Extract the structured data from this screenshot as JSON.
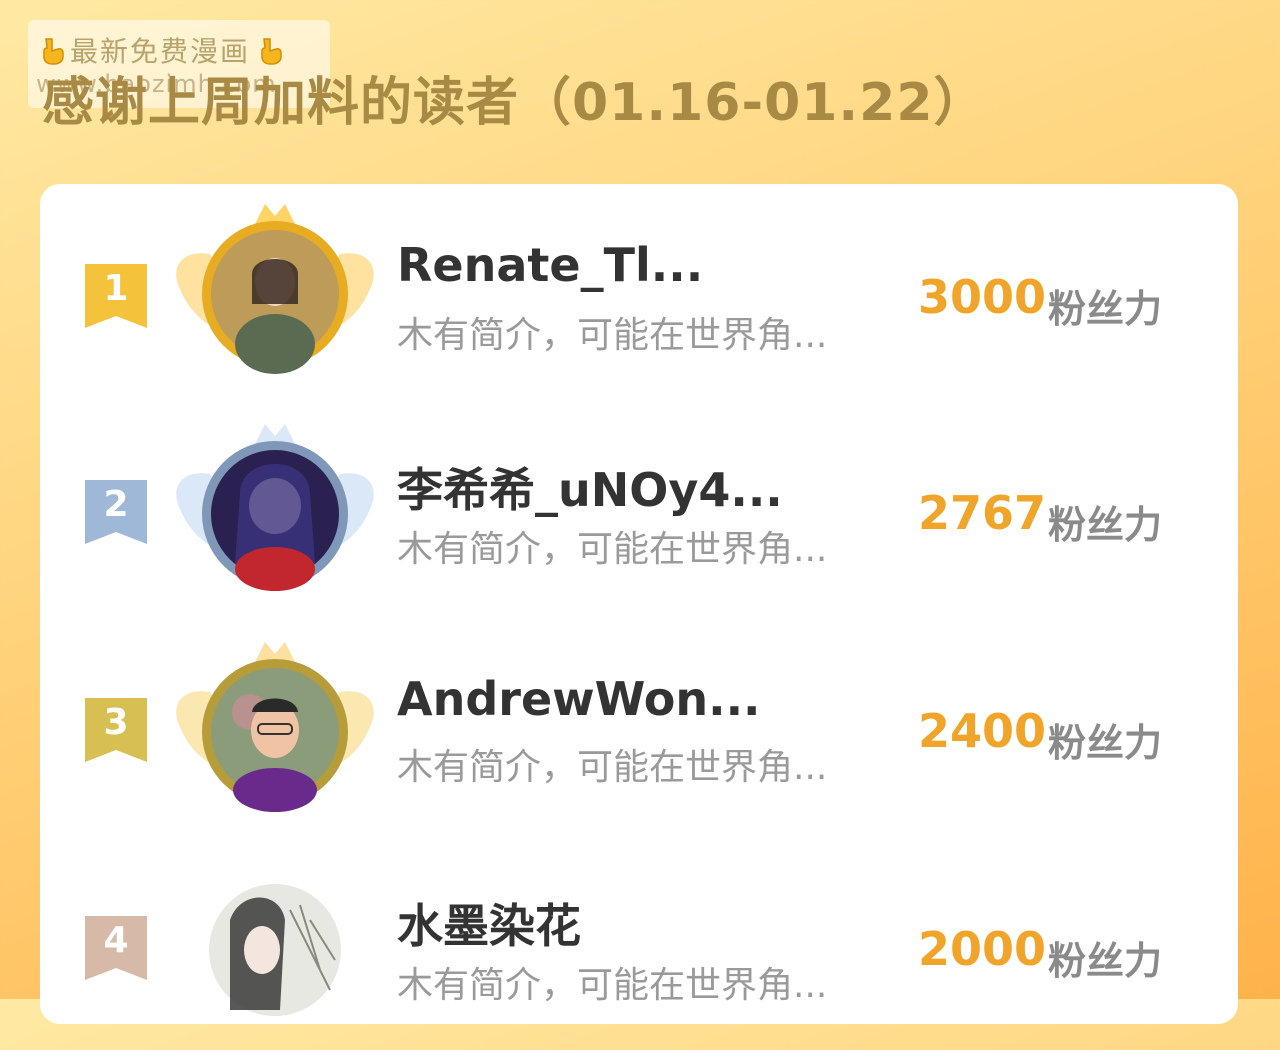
{
  "watermark": {
    "title": "最新免费漫画",
    "url": "www.baozimh.com",
    "icon": "pointing-hand-icon"
  },
  "header": {
    "title": "感谢上周加料的读者（01.16-01.22）"
  },
  "ranking": {
    "unit": "粉丝力",
    "items": [
      {
        "rank": "1",
        "username": "Renate_Tl...",
        "bio": "木有简介，可能在世界角...",
        "score": "3000",
        "flag_color": "#f5c33b",
        "ring_color": "#e8ac22"
      },
      {
        "rank": "2",
        "username": "李希希_uNOy4...",
        "bio": "木有简介，可能在世界角...",
        "score": "2767",
        "flag_color": "#9fb8d8",
        "ring_color": "#7f97b9"
      },
      {
        "rank": "3",
        "username": "AndrewWon...",
        "bio": "木有简介，可能在世界角...",
        "score": "2400",
        "flag_color": "#d8bf52",
        "ring_color": "#b79c3a"
      },
      {
        "rank": "4",
        "username": "水墨染花",
        "bio": "木有简介，可能在世界角...",
        "score": "2000",
        "flag_color": "#d6b9a6",
        "ring_color": "#e0e0e0"
      }
    ]
  }
}
